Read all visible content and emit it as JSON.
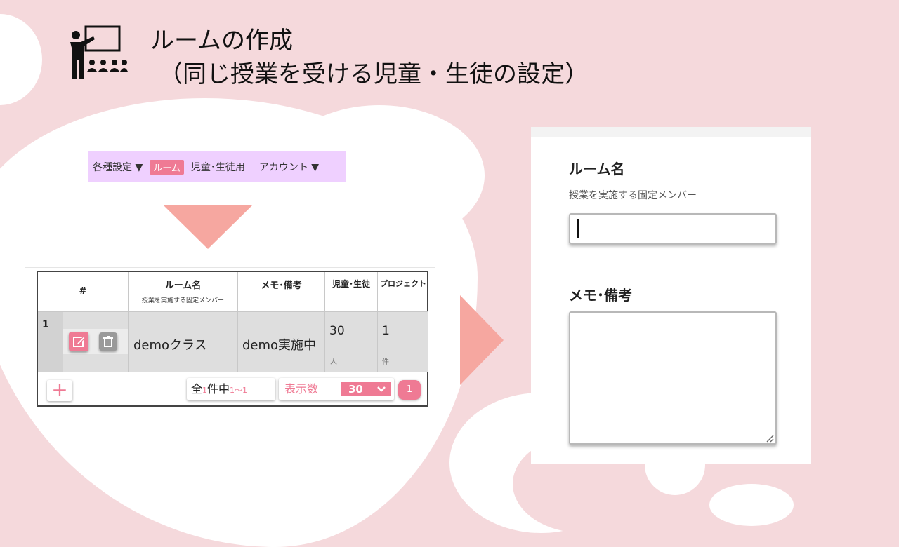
{
  "slide": {
    "title_line1": "ルームの作成",
    "title_line2": "（同じ授業を受ける児童・生徒の設定）",
    "icon": "teacher-classroom-icon"
  },
  "nav": {
    "settings_label": "各種設定 ▼",
    "room_label": "ルーム",
    "students_label": "児童･生徒用",
    "account_label": "アカウント ▼"
  },
  "table": {
    "headers": {
      "index": "#",
      "room_name": "ルーム名",
      "room_name_sub": "授業を実施する固定メンバー",
      "memo": "メモ･備考",
      "students": "児童･生徒",
      "projects": "プロジェクト"
    },
    "rows": [
      {
        "index": "1",
        "room_name": "demoクラス",
        "memo": "demo実施中",
        "students": "30",
        "students_unit": "人",
        "projects": "1",
        "projects_unit": "件"
      }
    ],
    "footer": {
      "add_label": "+",
      "count_prefix": "全",
      "count_total": "1",
      "count_mid": "件中",
      "count_range": "1～1",
      "perpage_label": "表示数",
      "perpage_value": "30",
      "page": "1"
    }
  },
  "form": {
    "room_name_label": "ルーム名",
    "room_name_sub": "授業を実施する固定メンバー",
    "room_name_value": "",
    "memo_label": "メモ･備考",
    "memo_value": ""
  },
  "colors": {
    "background": "#f5d9dc",
    "accent": "#ef7a94",
    "arrow": "#f6a7a0",
    "nav_bg": "#efd0ff"
  }
}
